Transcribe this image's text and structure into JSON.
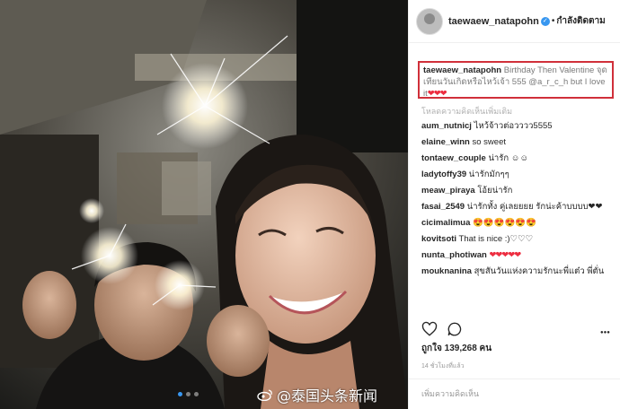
{
  "post": {
    "username": "taewaew_natapohn",
    "separator": "•",
    "follow_status": "กำลังติดตาม",
    "caption_line1": "Birthday Then",
    "caption_line2": "Valentine จุดเทียนวันเกิดหรือไหว้เจ้า 555",
    "caption_mention": "@a_r_c_h",
    "caption_tail": "but I love it",
    "caption_hearts": "❤❤❤",
    "load_more": "โหลดความคิดเห็นเพิ่มเติม",
    "likes": "ถูกใจ 139,268 คน",
    "time": "14 ชั่วโมงที่แล้ว",
    "add_comment_placeholder": "เพิ่มความคิดเห็น"
  },
  "comments": [
    {
      "user": "aum_nutnicj",
      "text": "ไหว้จ้าวต่อวววว5555"
    },
    {
      "user": "elaine_winn",
      "text": "so sweet"
    },
    {
      "user": "tontaew_couple",
      "text": "น่ารัก ☺☺"
    },
    {
      "user": "ladytoffy39",
      "text": "น่ารักมักๆๆ"
    },
    {
      "user": "meaw_piraya",
      "text": "โอ้ยน่ารัก"
    },
    {
      "user": "fasai_2549",
      "text": "น่ารักทั้ง คู่เลยยยย รักน่ะค้าบบบบ❤❤"
    },
    {
      "user": "cicimalimua",
      "text": "😍😍😍😍😍😍"
    },
    {
      "user": "kovitsoti",
      "text": "That is nice :)♡♡♡"
    },
    {
      "user": "nunta_photiwan",
      "text": "❤❤❤❤❤"
    },
    {
      "user": "mouknanina",
      "text": "สุขสันวันแห่งความรักนะพี่แต๋ว พี่ตั่น"
    }
  ],
  "watermark": {
    "text": "@泰国头条新闻"
  },
  "colors": {
    "highlight_border": "#d0303a",
    "verified": "#3897f0",
    "heart": "#ed2d40"
  }
}
